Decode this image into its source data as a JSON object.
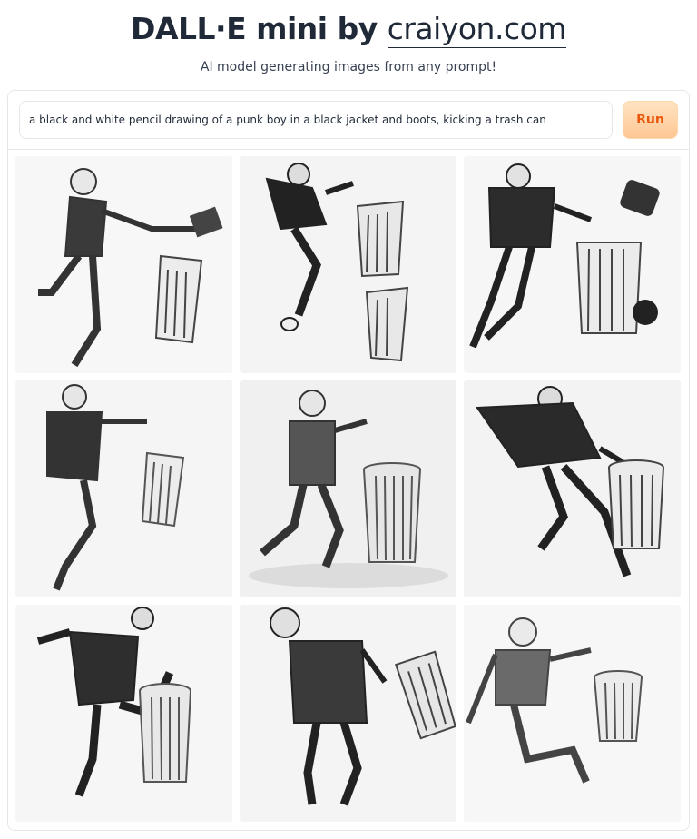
{
  "header": {
    "title_prefix": "DALL·E mini by ",
    "title_site": "craiyon.com",
    "subtitle": "AI model generating images from any prompt!"
  },
  "prompt": {
    "value": "a black and white pencil drawing of a punk boy in a black jacket and boots, kicking a trash can"
  },
  "run_button": {
    "label": "Run"
  },
  "colors": {
    "run_bg": "#fdc793",
    "run_text": "#ea580c",
    "sketch": "#2b2b2b"
  },
  "gallery": {
    "images": [
      {
        "name": "generated-image-1"
      },
      {
        "name": "generated-image-2"
      },
      {
        "name": "generated-image-3"
      },
      {
        "name": "generated-image-4"
      },
      {
        "name": "generated-image-5"
      },
      {
        "name": "generated-image-6"
      },
      {
        "name": "generated-image-7"
      },
      {
        "name": "generated-image-8"
      },
      {
        "name": "generated-image-9"
      }
    ]
  }
}
